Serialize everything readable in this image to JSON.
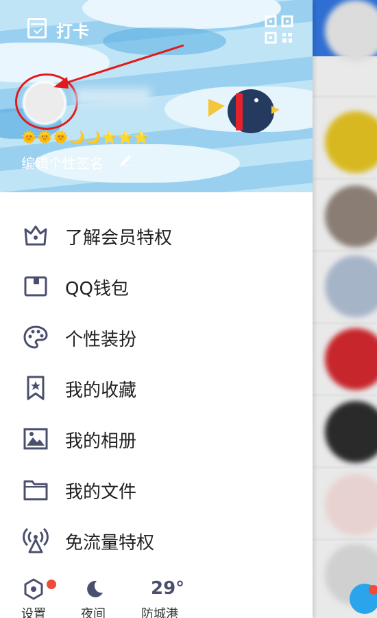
{
  "header": {
    "checkin_label": "打卡",
    "level_icons": "🌞🌞🌞🌙🌙⭐⭐⭐",
    "signature": "编辑个性签名"
  },
  "menu": {
    "items": [
      {
        "label": "了解会员特权",
        "icon": "crown-icon"
      },
      {
        "label": "QQ钱包",
        "icon": "wallet-icon"
      },
      {
        "label": "个性装扮",
        "icon": "palette-icon"
      },
      {
        "label": "我的收藏",
        "icon": "bookmark-star-icon"
      },
      {
        "label": "我的相册",
        "icon": "image-icon"
      },
      {
        "label": "我的文件",
        "icon": "folder-icon"
      },
      {
        "label": "免流量特权",
        "icon": "broadcast-icon"
      }
    ]
  },
  "bottom": {
    "settings_label": "设置",
    "night_label": "夜间",
    "weather_temp": "29°",
    "weather_city": "防城港"
  },
  "colors": {
    "accent_icon": "#4a4f6e",
    "header_bg": "#bfe4f6",
    "notification_red": "#f04a3a",
    "annotation_red": "#e21a1a"
  }
}
